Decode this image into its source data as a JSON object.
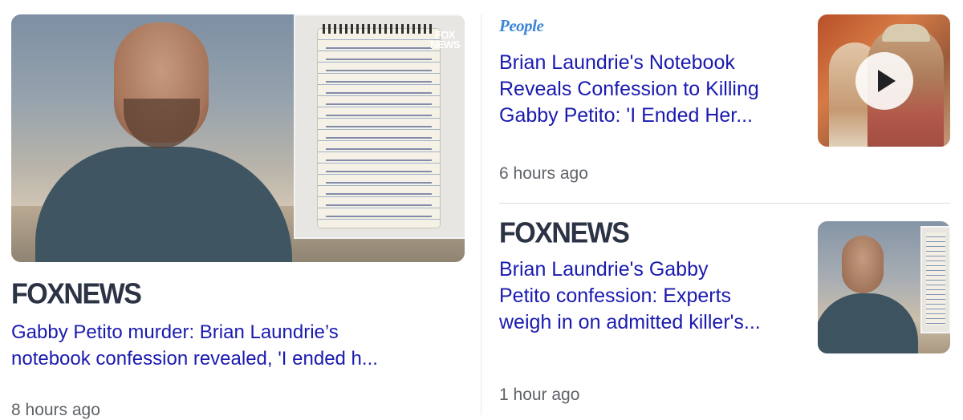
{
  "left_story": {
    "image_alt": "Brian Laundrie and notebook",
    "watermark_line1": "FOX",
    "watermark_line2": "NEWS",
    "source": "FOXNEWS",
    "headline_line1": "Gabby Petito murder: Brian Laundrie’s",
    "headline_line2": "notebook confession revealed, 'I ended h...",
    "time": "8 hours ago"
  },
  "right_stories": [
    {
      "source": "People",
      "headline_line1": "Brian Laundrie's Notebook",
      "headline_line2": "Reveals Confession to Killing",
      "headline_line3": "Gabby Petito: 'I Ended Her...",
      "time": "6 hours ago",
      "has_video": true
    },
    {
      "source": "FOXNEWS",
      "headline_line1": "Brian Laundrie's Gabby",
      "headline_line2": "Petito confession: Experts",
      "headline_line3": "weigh in on admitted killer's...",
      "time": "1 hour ago",
      "has_video": false
    }
  ],
  "colors": {
    "headline": "#1a1ab0",
    "time": "#5f6368",
    "fox_logo": "#2c3345",
    "people_logo": "#3b87d6"
  }
}
